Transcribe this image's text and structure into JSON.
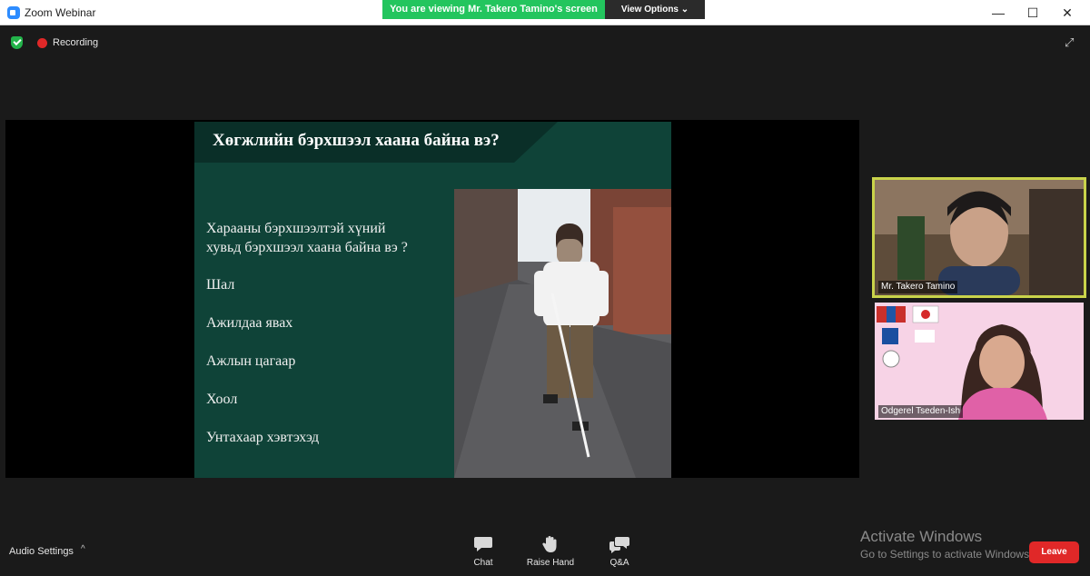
{
  "window": {
    "title": "Zoom Webinar",
    "minimize": "—",
    "maximize": "☐",
    "close": "✕"
  },
  "banner": {
    "text": "You are viewing Mr. Takero Tamino's screen",
    "view_options": "View Options ⌄"
  },
  "status": {
    "recording": "Recording",
    "expand_icon": "⤢"
  },
  "slide": {
    "title": "Хөгжлийн бэрхшээл хаана байна вэ?",
    "question_line1": "Хараany бэрхшээлтэй хүний",
    "question_line2": "хувьд бэрхшээл хаана байна вэ ?",
    "items": [
      "Шал",
      "Ажилдаа явах",
      "Ажлын цагаар",
      "Хоол",
      "Унтахаар хэвтэхэд"
    ]
  },
  "participants": [
    {
      "name": "Mr. Takero Tamino",
      "active_speaker": true,
      "border_color": "#c9d34a"
    },
    {
      "name": "Odgerel Tseden-Ish",
      "active_speaker": false
    }
  ],
  "toolbar": {
    "audio_settings": "Audio Settings",
    "audio_caret": "^",
    "chat": "Chat",
    "raise_hand": "Raise Hand",
    "qa": "Q&A",
    "leave": "Leave"
  },
  "watermark": {
    "line1": "Activate Windows",
    "line2": "Go to Settings to activate Windows."
  },
  "colors": {
    "banner_green": "#23c55e",
    "leave_red": "#e02828",
    "slide_bg": "#0f4338"
  }
}
